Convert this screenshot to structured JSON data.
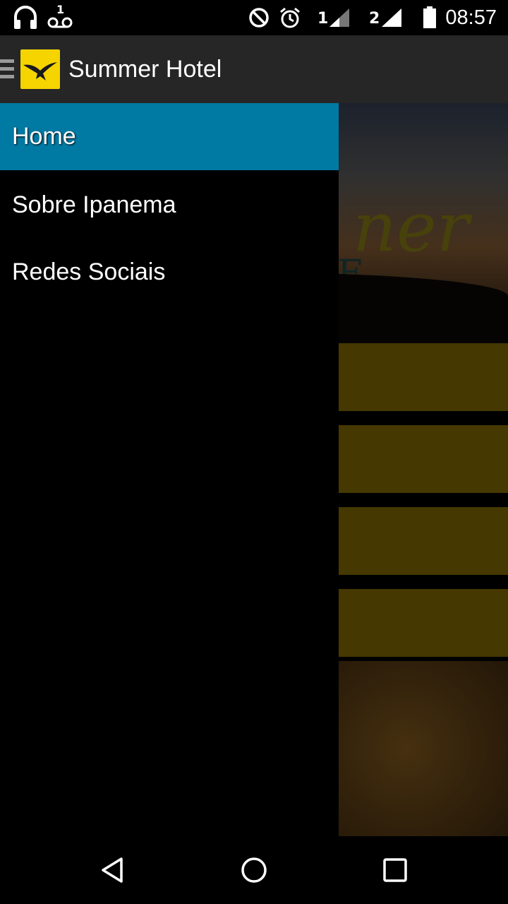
{
  "status_bar": {
    "time": "08:57",
    "voicemail_count": "1",
    "sim1_label": "1",
    "sim2_label": "2",
    "icons": [
      "headphones-icon",
      "voicemail-icon",
      "do-not-disturb-icon",
      "alarm-icon",
      "signal-icon",
      "battery-icon"
    ]
  },
  "action_bar": {
    "title": "Summer Hotel",
    "logo_color": "#f5d400"
  },
  "drawer": {
    "items": [
      {
        "label": "Home",
        "active": true
      },
      {
        "label": "Sobre Ipanema",
        "active": false
      },
      {
        "label": "Redes Sociais",
        "active": false
      }
    ],
    "active_color": "#0079a3"
  },
  "background": {
    "logo_text_partial": "ner",
    "logo_sub_partial": "E  L",
    "button_color": "#6a5600"
  },
  "nav_bar": {
    "icons": [
      "back-icon",
      "home-icon",
      "recents-icon"
    ]
  }
}
